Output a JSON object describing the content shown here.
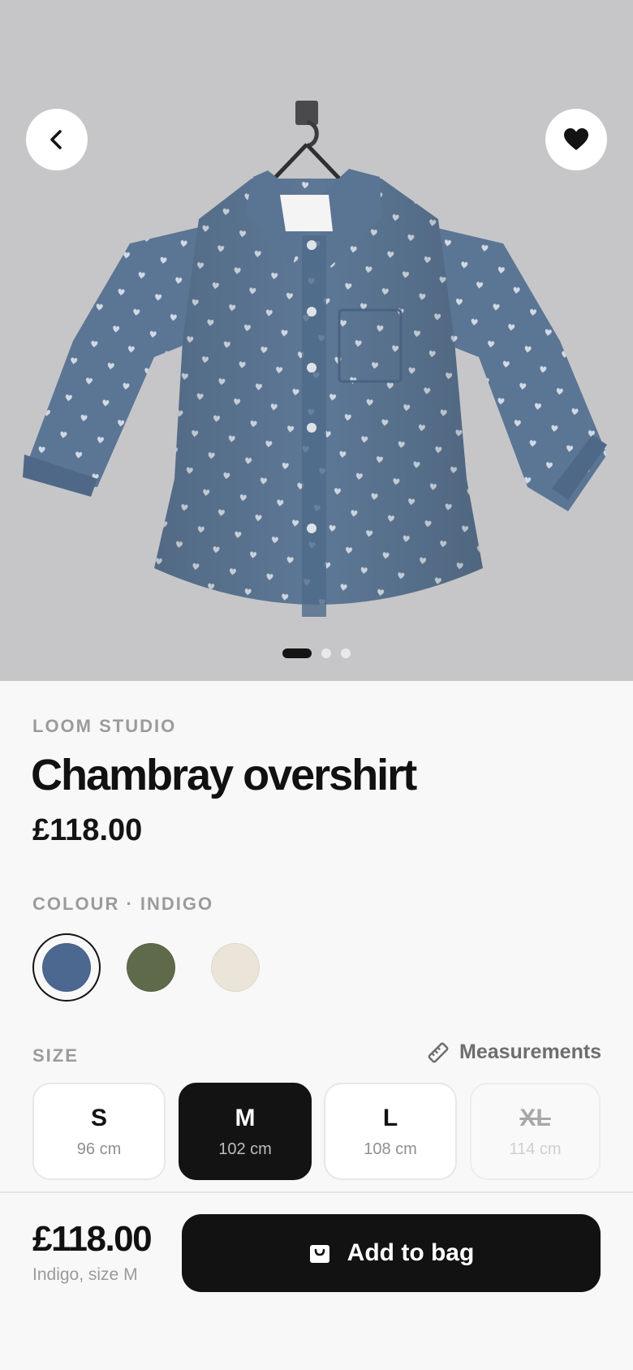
{
  "product": {
    "brand": "LOOM STUDIO",
    "title": "Chambray overshirt",
    "price": "£118.00"
  },
  "gallery": {
    "image_count": 3,
    "active_index": 0
  },
  "colour": {
    "label": "COLOUR · INDIGO",
    "options": [
      {
        "name": "Indigo",
        "hex": "#4d6890",
        "selected": true
      },
      {
        "name": "Olive",
        "hex": "#5e6a4a",
        "selected": false
      },
      {
        "name": "Ecru",
        "hex": "#ebe5d9",
        "selected": false
      }
    ]
  },
  "size": {
    "label": "SIZE",
    "measurements_label": "Measurements",
    "options": [
      {
        "name": "S",
        "cm": "96 cm",
        "state": "available"
      },
      {
        "name": "M",
        "cm": "102 cm",
        "state": "selected"
      },
      {
        "name": "L",
        "cm": "108 cm",
        "state": "available"
      },
      {
        "name": "XL",
        "cm": "114 cm",
        "state": "sold-out"
      }
    ]
  },
  "cart_bar": {
    "price": "£118.00",
    "summary": "Indigo, size M",
    "button_label": "Add to bag"
  },
  "icons": {
    "back": "chevron-left-icon",
    "favorite": "heart-icon",
    "measure": "ruler-icon",
    "bag": "shopping-bag-icon"
  },
  "colors": {
    "hero_bg": "#c6c6c8",
    "ink": "#131313",
    "muted": "#9b9b9b"
  }
}
